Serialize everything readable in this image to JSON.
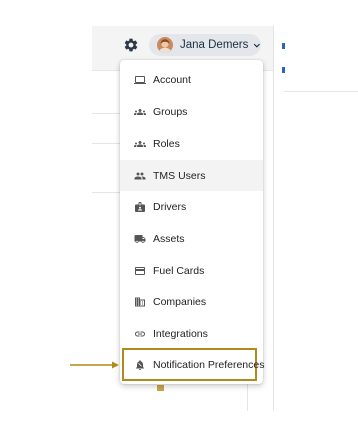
{
  "user": {
    "name": "Jana Demers"
  },
  "icons": {
    "settings": "gear-icon",
    "dropdown": "chevron-down-icon",
    "pointer": "arrow-right-icon"
  },
  "colors": {
    "highlight_border": "#b08a1e",
    "active_row_bg": "#f3f3f3",
    "chip_bg": "#e3e7ec",
    "icon_gray": "#555555"
  },
  "menu": {
    "items": [
      {
        "label": "Account",
        "icon": "laptop-icon"
      },
      {
        "label": "Groups",
        "icon": "groups-icon"
      },
      {
        "label": "Roles",
        "icon": "roles-icon"
      },
      {
        "label": "TMS Users",
        "icon": "people-icon",
        "state": "hovered"
      },
      {
        "label": "Drivers",
        "icon": "driver-badge-icon"
      },
      {
        "label": "Assets",
        "icon": "truck-icon"
      },
      {
        "label": "Fuel Cards",
        "icon": "credit-card-icon"
      },
      {
        "label": "Companies",
        "icon": "building-icon"
      },
      {
        "label": "Integrations",
        "icon": "link-icon"
      },
      {
        "label": "Notification Preferences",
        "icon": "bell-settings-icon",
        "state": "highlighted"
      }
    ]
  }
}
